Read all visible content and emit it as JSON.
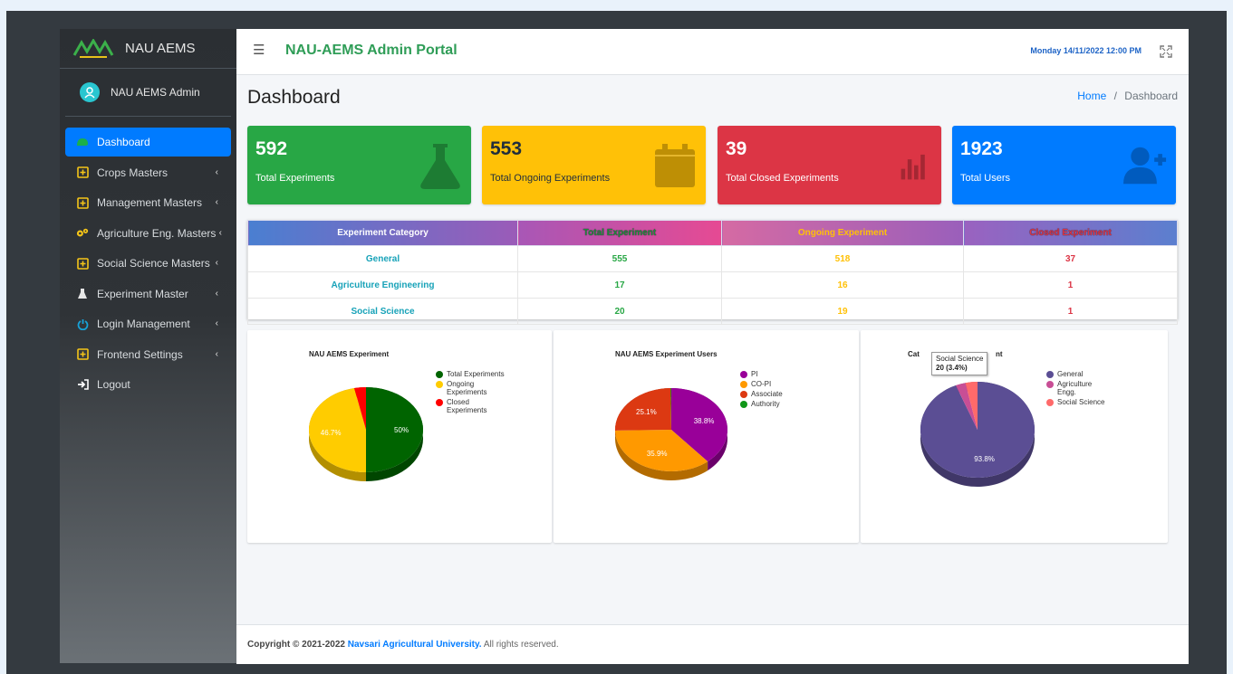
{
  "brand": {
    "name": "NAU AEMS"
  },
  "user": {
    "name": "NAU AEMS Admin"
  },
  "sidebar": {
    "items": [
      {
        "label": "Dashboard",
        "icon": "palette-icon",
        "chevron": ""
      },
      {
        "label": "Crops Masters",
        "icon": "plus-square-icon",
        "chevron": "‹"
      },
      {
        "label": "Management Masters",
        "icon": "plus-square-icon",
        "chevron": "‹"
      },
      {
        "label": "Agriculture Eng. Masters",
        "icon": "cogs-icon",
        "chevron": "‹"
      },
      {
        "label": "Social Science Masters",
        "icon": "plus-square-icon",
        "chevron": "‹"
      },
      {
        "label": "Experiment Master",
        "icon": "flask-icon",
        "chevron": "‹"
      },
      {
        "label": "Login Management",
        "icon": "power-icon",
        "chevron": "‹"
      },
      {
        "label": "Frontend Settings",
        "icon": "plus-square-icon",
        "chevron": "‹"
      },
      {
        "label": "Logout",
        "icon": "sign-in-icon",
        "chevron": ""
      }
    ]
  },
  "header": {
    "title": "NAU-AEMS Admin Portal",
    "datetime": "Monday 14/11/2022 12:00 PM"
  },
  "page": {
    "title": "Dashboard",
    "breadcrumb_home": "Home",
    "breadcrumb_sep": "/",
    "breadcrumb_current": "Dashboard"
  },
  "stats": [
    {
      "value": "592",
      "label": "Total Experiments",
      "color": "#28a745",
      "icon": "flask-icon"
    },
    {
      "value": "553",
      "label": "Total Ongoing Experiments",
      "color": "#ffc107",
      "icon": "calendar-icon"
    },
    {
      "value": "39",
      "label": "Total Closed Experiments",
      "color": "#dc3545",
      "icon": "bar-chart-icon"
    },
    {
      "value": "1923",
      "label": "Total Users",
      "color": "#007bff",
      "icon": "user-plus-icon"
    }
  ],
  "table": {
    "headers": [
      "Experiment Category",
      "Total Experiment",
      "Ongoing Experiment",
      "Closed Experiment"
    ],
    "rows": [
      [
        "General",
        "555",
        "518",
        "37"
      ],
      [
        "Agriculture Engineering",
        "17",
        "16",
        "1"
      ],
      [
        "Social Science",
        "20",
        "19",
        "1"
      ]
    ]
  },
  "charts": {
    "experiment": {
      "title": "NAU AEMS Experiment"
    },
    "users": {
      "title": "NAU AEMS Experiment Users"
    },
    "category": {
      "title_left": "Cat",
      "title_right": "nt",
      "tooltip_label": "Social Science",
      "tooltip_value": "20 (3.4%)"
    }
  },
  "chart_data": [
    {
      "type": "pie",
      "title": "NAU AEMS Experiment",
      "labels": [
        "Total Experiments",
        "Ongoing Experiments",
        "Closed Experiments"
      ],
      "values": [
        50,
        46.7,
        3.3
      ],
      "data_labels": [
        "50%",
        "46.7%",
        ""
      ],
      "colors": [
        "#006400",
        "#ffcc00",
        "#ff0000"
      ],
      "legend": "right"
    },
    {
      "type": "pie",
      "title": "NAU AEMS Experiment Users",
      "labels": [
        "PI",
        "CO-PI",
        "Associate",
        "Authority"
      ],
      "values": [
        38.8,
        35.9,
        25.1,
        0.2
      ],
      "data_labels": [
        "38.8%",
        "35.9%",
        "25.1%",
        ""
      ],
      "colors": [
        "#990099",
        "#ff9900",
        "#dc3912",
        "#109618"
      ],
      "legend": "right"
    },
    {
      "type": "pie",
      "title": "",
      "labels": [
        "General",
        "Agriculture Engg.",
        "Social Science"
      ],
      "values": [
        93.8,
        2.8,
        3.4
      ],
      "data_labels": [
        "93.8%",
        "",
        ""
      ],
      "colors": [
        "#5b4e94",
        "#c84e95",
        "#ff6a6a"
      ],
      "legend": "right"
    }
  ],
  "footer": {
    "prefix": "Copyright © 2021-2022 ",
    "org": "Navsari Agricultural University.",
    "suffix": " All rights reserved."
  }
}
